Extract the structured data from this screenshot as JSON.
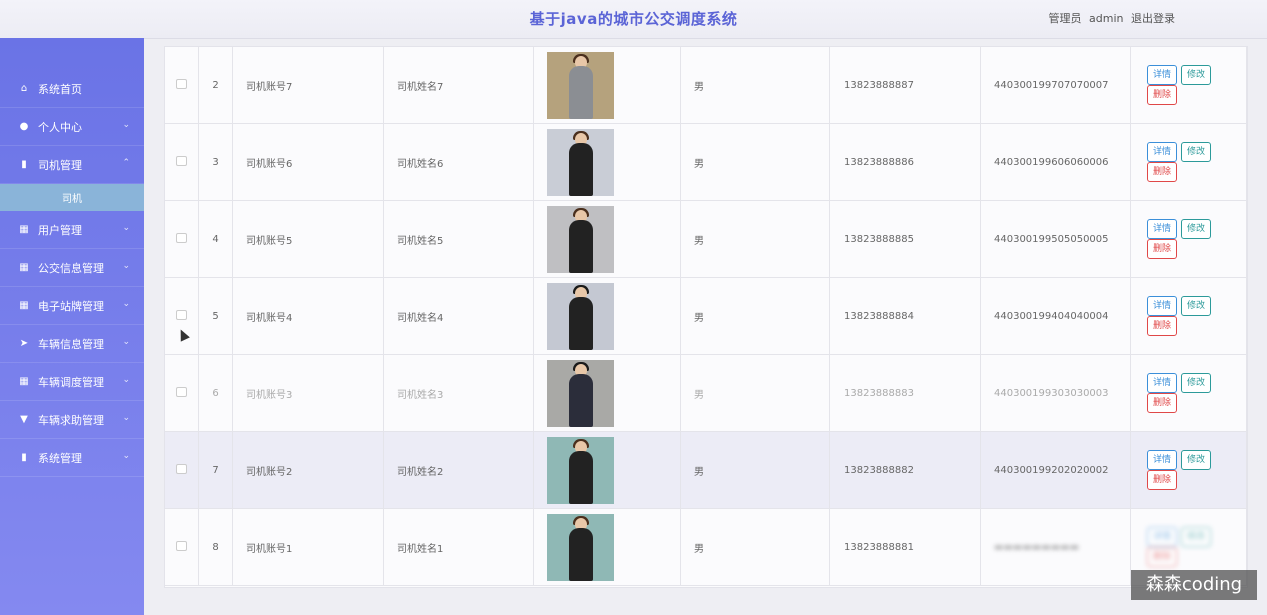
{
  "header": {
    "title": "基于java的城市公交调度系统",
    "role": "管理员",
    "username": "admin",
    "logout": "退出登录"
  },
  "sidebar": {
    "items": [
      {
        "label": "系统首页",
        "icon": "home-icon"
      },
      {
        "label": "个人中心",
        "icon": "user-icon",
        "chevron": "down"
      },
      {
        "label": "司机管理",
        "icon": "clipboard-icon",
        "chevron": "up"
      },
      {
        "label": "用户管理",
        "icon": "grid-icon",
        "chevron": "down"
      },
      {
        "label": "公交信息管理",
        "icon": "grid-icon",
        "chevron": "down"
      },
      {
        "label": "电子站牌管理",
        "icon": "grid-icon",
        "chevron": "down"
      },
      {
        "label": "车辆信息管理",
        "icon": "send-icon",
        "chevron": "down"
      },
      {
        "label": "车辆调度管理",
        "icon": "grid-icon",
        "chevron": "down"
      },
      {
        "label": "车辆求助管理",
        "icon": "trophy-icon",
        "chevron": "down"
      },
      {
        "label": "系统管理",
        "icon": "clipboard-icon",
        "chevron": "down"
      }
    ],
    "sub_item": "司机"
  },
  "table": {
    "rows": [
      {
        "index": "2",
        "account": "司机账号7",
        "name": "司机姓名7",
        "sex": "男",
        "phone": "13823888887",
        "id_card": "440300199707070007"
      },
      {
        "index": "3",
        "account": "司机账号6",
        "name": "司机姓名6",
        "sex": "男",
        "phone": "13823888886",
        "id_card": "440300199606060006"
      },
      {
        "index": "4",
        "account": "司机账号5",
        "name": "司机姓名5",
        "sex": "男",
        "phone": "13823888885",
        "id_card": "440300199505050005"
      },
      {
        "index": "5",
        "account": "司机账号4",
        "name": "司机姓名4",
        "sex": "男",
        "phone": "13823888884",
        "id_card": "440300199404040004"
      },
      {
        "index": "6",
        "account": "司机账号3",
        "name": "司机姓名3",
        "sex": "男",
        "phone": "13823888883",
        "id_card": "440300199303030003"
      },
      {
        "index": "7",
        "account": "司机账号2",
        "name": "司机姓名2",
        "sex": "男",
        "phone": "13823888882",
        "id_card": "440300199202020002"
      },
      {
        "index": "8",
        "account": "司机账号1",
        "name": "司机姓名1",
        "sex": "男",
        "phone": "13823888881",
        "id_card": ""
      }
    ],
    "actions": {
      "detail": "详情",
      "edit": "修改",
      "delete": "删除"
    }
  },
  "colors": {
    "sidebar_top": "#6a73e6",
    "sidebar_bottom": "#8489f0",
    "title": "#5b64d6",
    "detail": "#3b8fd9",
    "edit": "#2c9a9a",
    "delete": "#e04848",
    "submenu_active": "#8ab4d9"
  },
  "watermark": "森森coding"
}
